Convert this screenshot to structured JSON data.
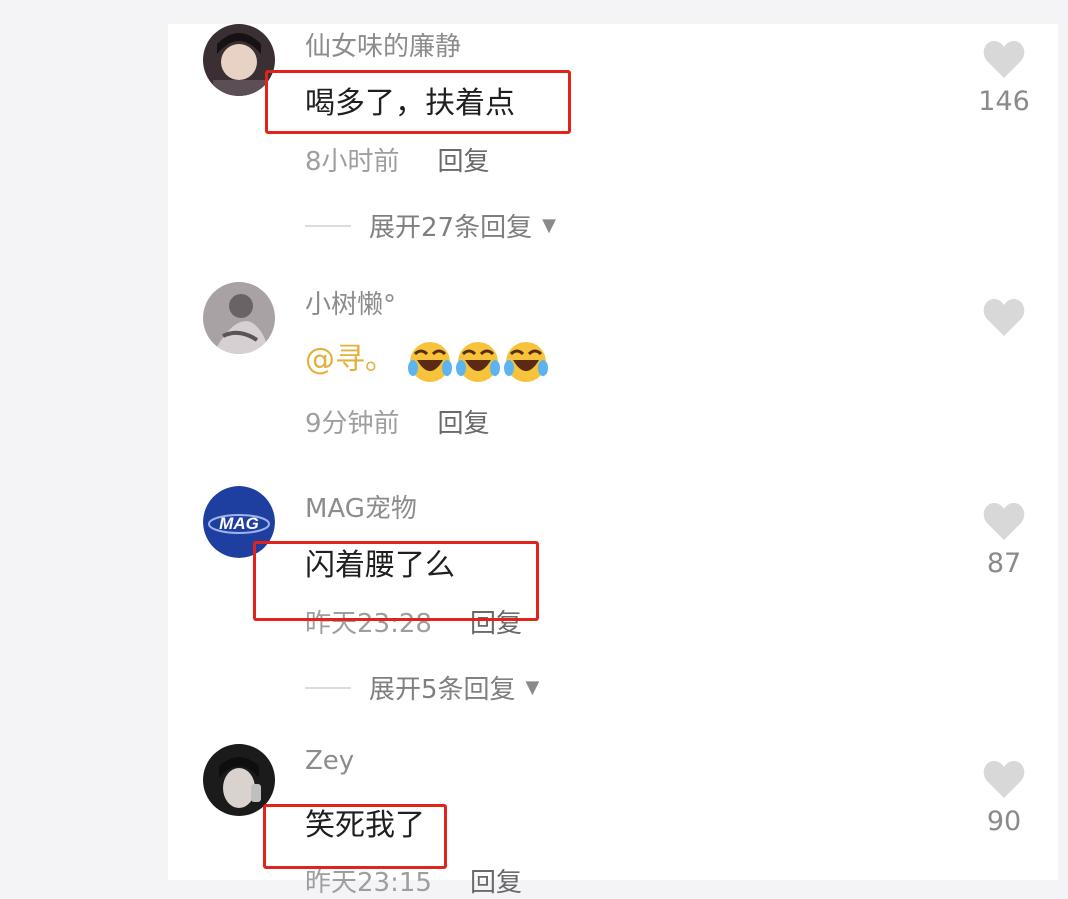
{
  "comments": [
    {
      "username": "仙女味的廉静",
      "text": "喝多了，扶着点",
      "time": "8小时前",
      "reply_label": "回复",
      "likes": "146",
      "expand_label": "展开27条回复",
      "avatar_colors": [
        "#d9c2b4",
        "#2a2326"
      ]
    },
    {
      "username": "小树懒°",
      "mention": "@寻。",
      "emojis": [
        "laughing-crying-emoji",
        "laughing-crying-emoji",
        "laughing-crying-emoji"
      ],
      "time": "9分钟前",
      "reply_label": "回复",
      "likes": "",
      "avatar_colors": [
        "#b9b1b3",
        "#5a5456"
      ]
    },
    {
      "username": "MAG宠物",
      "text": "闪着腰了么",
      "time": "昨天23:28",
      "reply_label": "回复",
      "likes": "87",
      "expand_label": "展开5条回复",
      "avatar_colors": [
        "#1f3fa0",
        "#ffffff"
      ],
      "avatar_logo_text": "MAG"
    },
    {
      "username": "Zey",
      "text": "笑死我了",
      "time": "昨天23:15",
      "reply_label": "回复",
      "likes": "90",
      "avatar_colors": [
        "#c7c7c7",
        "#1a1a1a"
      ]
    }
  ],
  "colors": {
    "highlight": "#e2231a",
    "mention": "#e2b13c",
    "heart": "#d8d8d8"
  }
}
